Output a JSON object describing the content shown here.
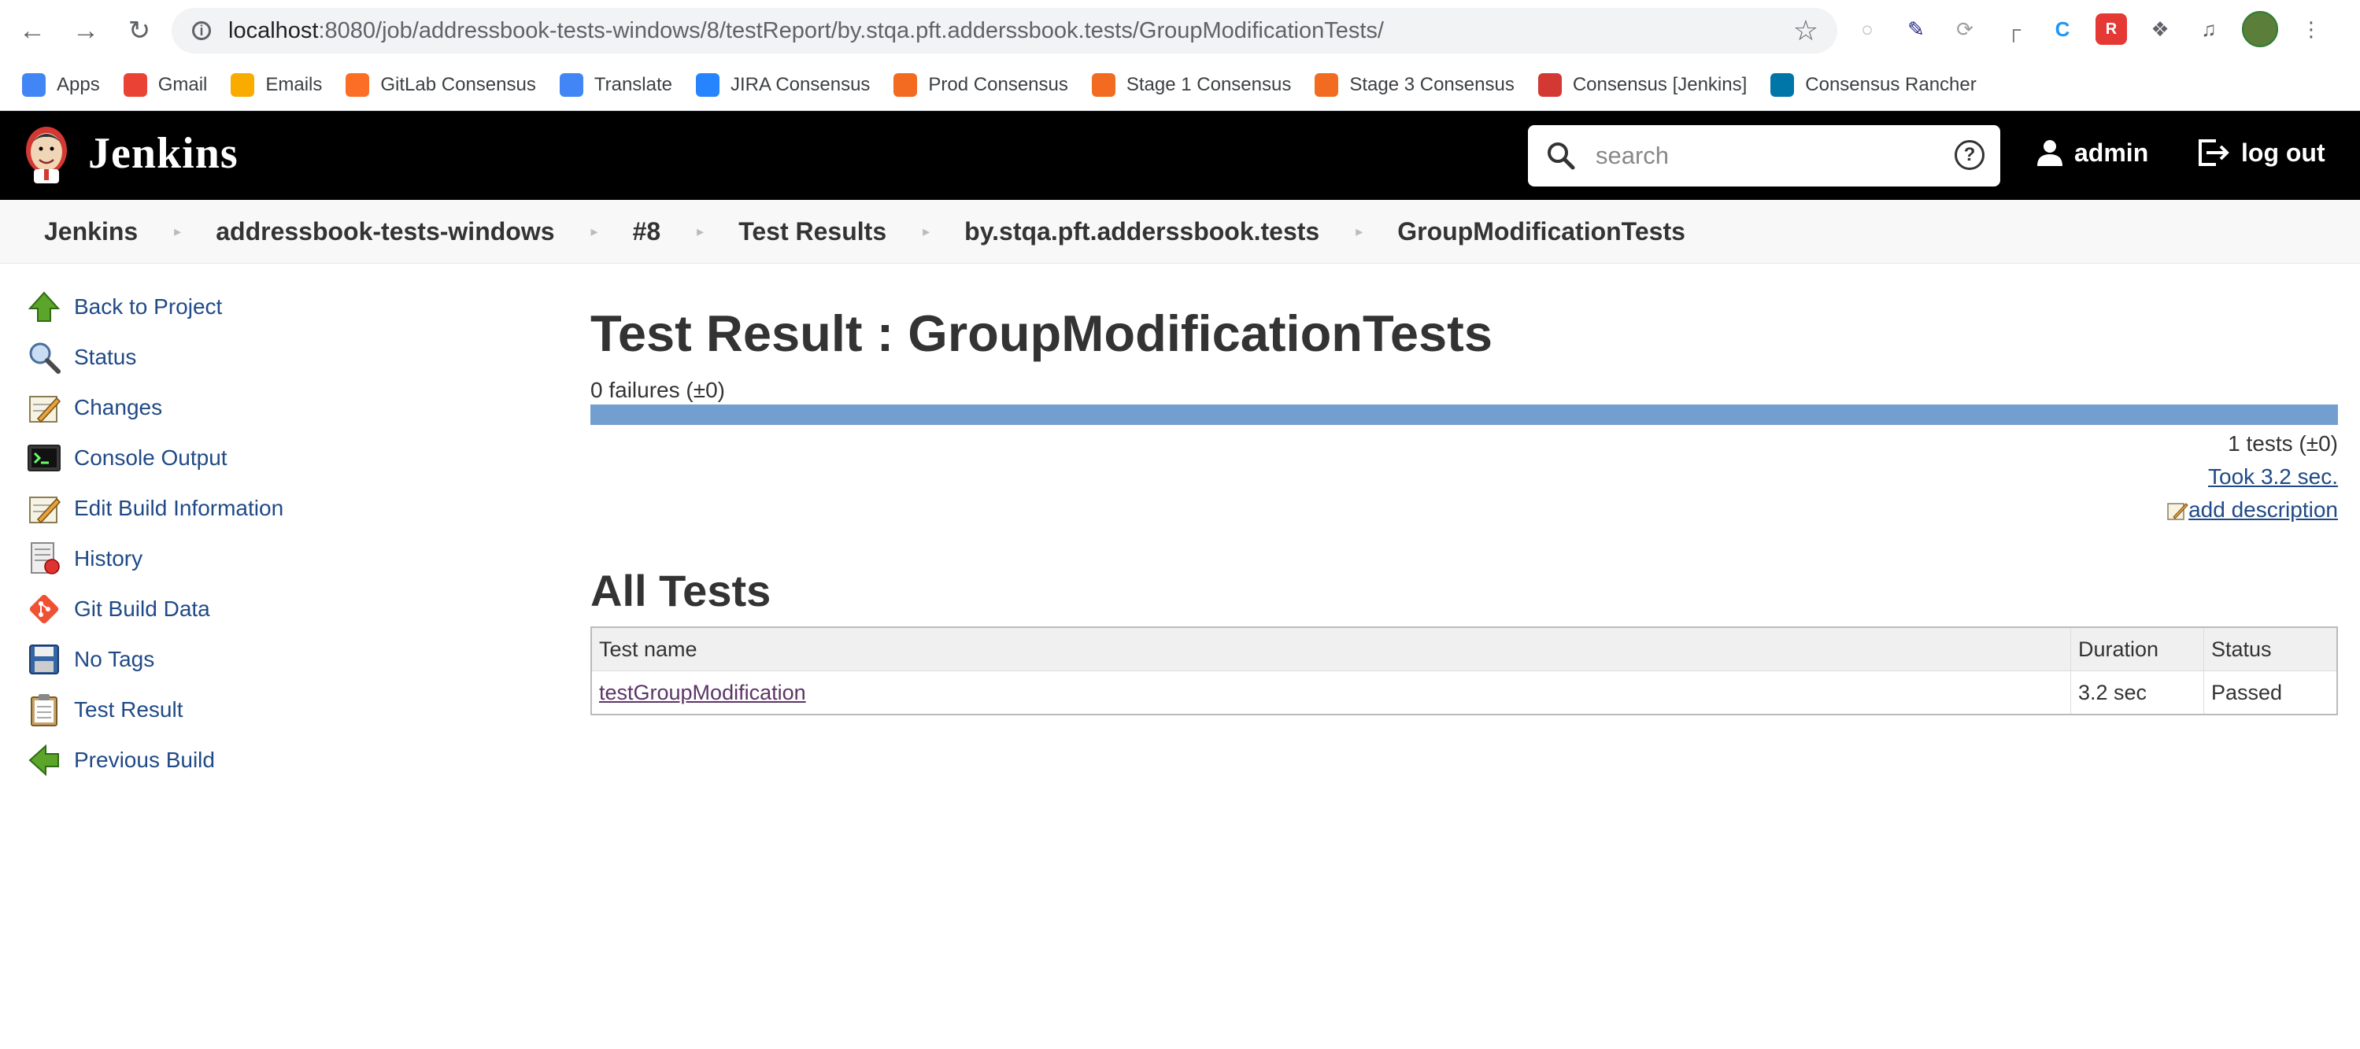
{
  "browser": {
    "url_host": "localhost",
    "url_rest": ":8080/job/addressbook-tests-windows/8/testReport/by.stqa.pft.adderssbook.tests/GroupModificationTests/",
    "bookmarks": [
      {
        "label": "Apps",
        "icon": "apps-grid-icon",
        "color": "#4285f4"
      },
      {
        "label": "Gmail",
        "icon": "gmail-icon",
        "color": "#ea4335"
      },
      {
        "label": "Emails",
        "icon": "mail-icon",
        "color": "#f9ab00"
      },
      {
        "label": "GitLab Consensus",
        "icon": "gitlab-icon",
        "color": "#fc6d26"
      },
      {
        "label": "Translate",
        "icon": "translate-icon",
        "color": "#4285f4"
      },
      {
        "label": "JIRA Consensus",
        "icon": "jira-icon",
        "color": "#2684ff"
      },
      {
        "label": "Prod Consensus",
        "icon": "consensus-icon",
        "color": "#f26b21"
      },
      {
        "label": "Stage 1 Consensus",
        "icon": "consensus-icon",
        "color": "#f26b21"
      },
      {
        "label": "Stage 3 Consensus",
        "icon": "consensus-icon",
        "color": "#f26b21"
      },
      {
        "label": "Consensus [Jenkins]",
        "icon": "jenkins-icon",
        "color": "#d33833"
      },
      {
        "label": "Consensus Rancher",
        "icon": "rancher-icon",
        "color": "#0075a8"
      }
    ]
  },
  "header": {
    "title": "Jenkins",
    "search_placeholder": "search",
    "user": "admin",
    "logout": "log out"
  },
  "breadcrumbs": [
    "Jenkins",
    "addressbook-tests-windows",
    "#8",
    "Test Results",
    "by.stqa.pft.adderssbook.tests",
    "GroupModificationTests"
  ],
  "sidebar": [
    {
      "label": "Back to Project",
      "icon": "up-arrow-icon"
    },
    {
      "label": "Status",
      "icon": "magnifier-icon"
    },
    {
      "label": "Changes",
      "icon": "notepad-icon"
    },
    {
      "label": "Console Output",
      "icon": "terminal-icon"
    },
    {
      "label": "Edit Build Information",
      "icon": "notepad-icon"
    },
    {
      "label": "History",
      "icon": "history-icon"
    },
    {
      "label": "Git Build Data",
      "icon": "git-icon"
    },
    {
      "label": "No Tags",
      "icon": "save-icon"
    },
    {
      "label": "Test Result",
      "icon": "clipboard-icon"
    },
    {
      "label": "Previous Build",
      "icon": "left-arrow-icon"
    }
  ],
  "main": {
    "title": "Test Result : GroupModificationTests",
    "failures": "0 failures (±0)",
    "pass_fraction": 1.0,
    "tests_count": "1 tests (±0)",
    "took": "Took 3.2 sec.",
    "add_description": "add description",
    "all_tests_heading": "All Tests",
    "table": {
      "headers": [
        "Test name",
        "Duration",
        "Status"
      ],
      "rows": [
        {
          "name": "testGroupModification",
          "duration": "3.2 sec",
          "status": "Passed"
        }
      ]
    }
  },
  "colors": {
    "header_bg": "#000000",
    "progress_bar": "#729fcf",
    "link": "#204a87",
    "visited_link": "#5c3566"
  }
}
